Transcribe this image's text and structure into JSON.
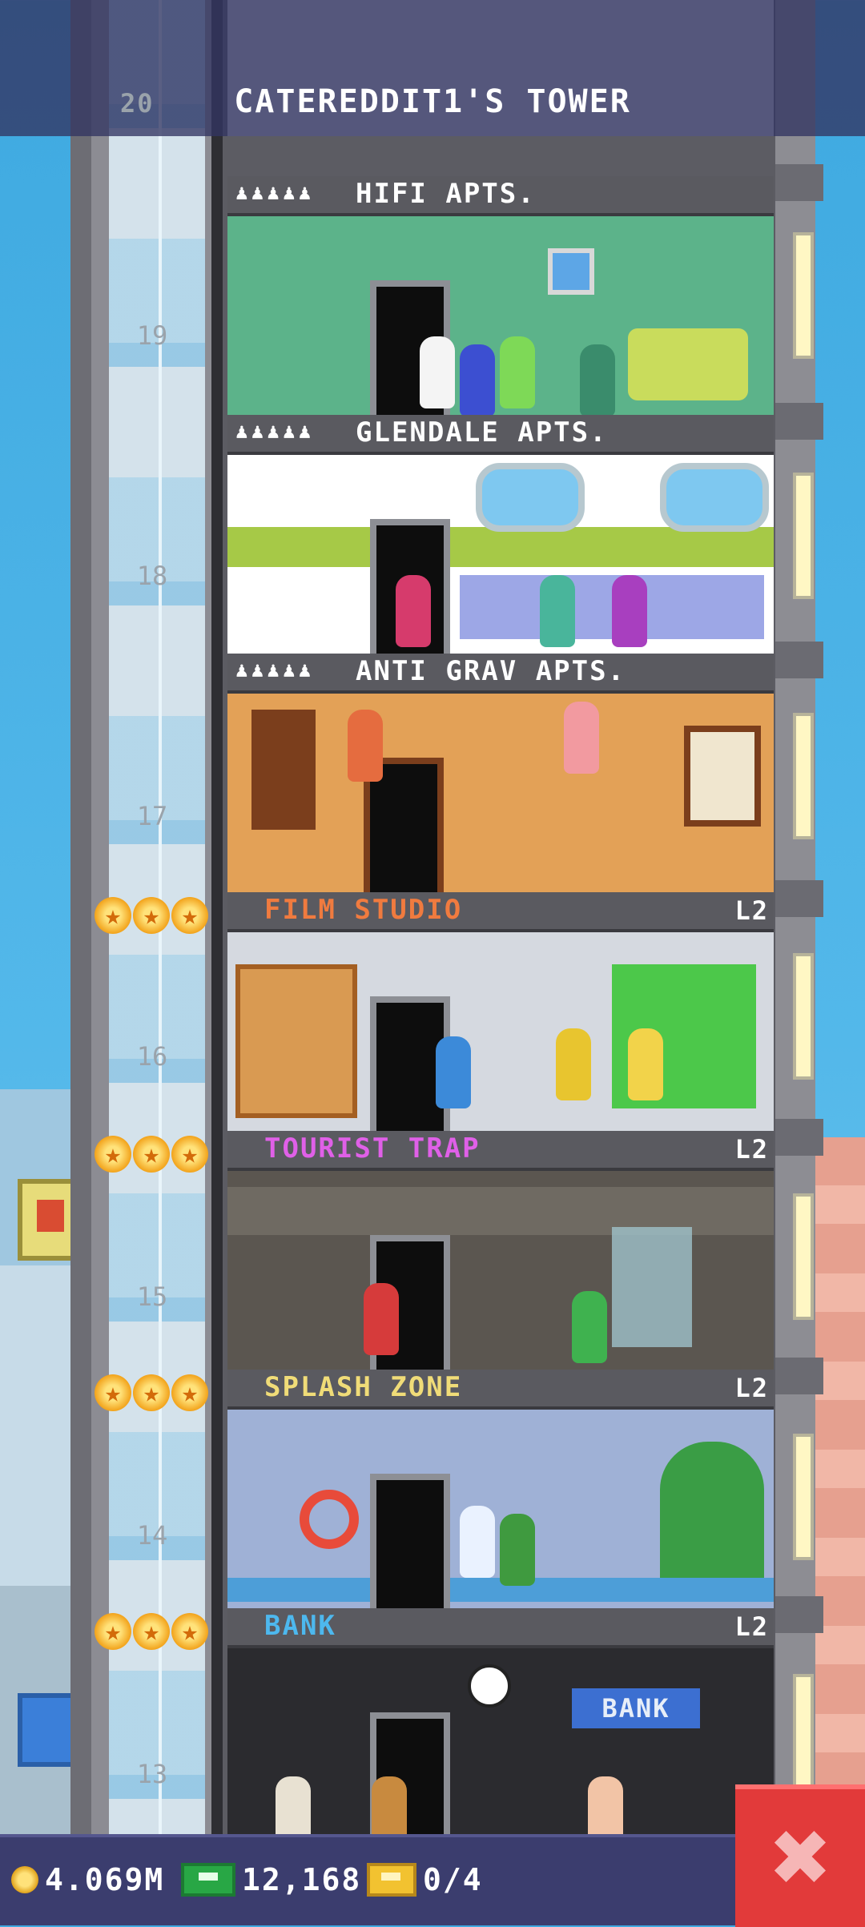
{
  "header": {
    "title": "CATEREDDIT1'S TOWER",
    "top_floor_number": "20"
  },
  "floors": [
    {
      "number": "19",
      "name": "HIFI APTS.",
      "type": "residential",
      "residents_icon": "♟♟♟♟♟"
    },
    {
      "number": "18",
      "name": "GLENDALE APTS.",
      "type": "residential",
      "residents_icon": "♟♟♟♟♟"
    },
    {
      "number": "17",
      "name": "ANTI GRAV APTS.",
      "type": "residential",
      "residents_icon": "♟♟♟♟♟"
    },
    {
      "number": "16",
      "name": "FILM STUDIO",
      "type": "business",
      "level": "L2",
      "stars": 3,
      "color": "#f07b3f"
    },
    {
      "number": "15",
      "name": "TOURIST TRAP",
      "type": "business",
      "level": "L2",
      "stars": 3,
      "color": "#e060e8"
    },
    {
      "number": "14",
      "name": "SPLASH ZONE",
      "type": "business",
      "level": "L2",
      "stars": 3,
      "color": "#f0dc78"
    },
    {
      "number": "13",
      "name": "BANK",
      "type": "business",
      "level": "L2",
      "stars": 3,
      "color": "#4db8ee"
    }
  ],
  "bank_sign": "BANK",
  "status_bar": {
    "coins": "4.069M",
    "bux": "12,168",
    "tickets": "0/4"
  },
  "close_button": {
    "icon": "close-icon",
    "glyph": "✖"
  },
  "colors": {
    "header_bg": "#323462",
    "bottom_bar_bg": "#3b3d6e",
    "close_bg": "#e23a3a"
  }
}
